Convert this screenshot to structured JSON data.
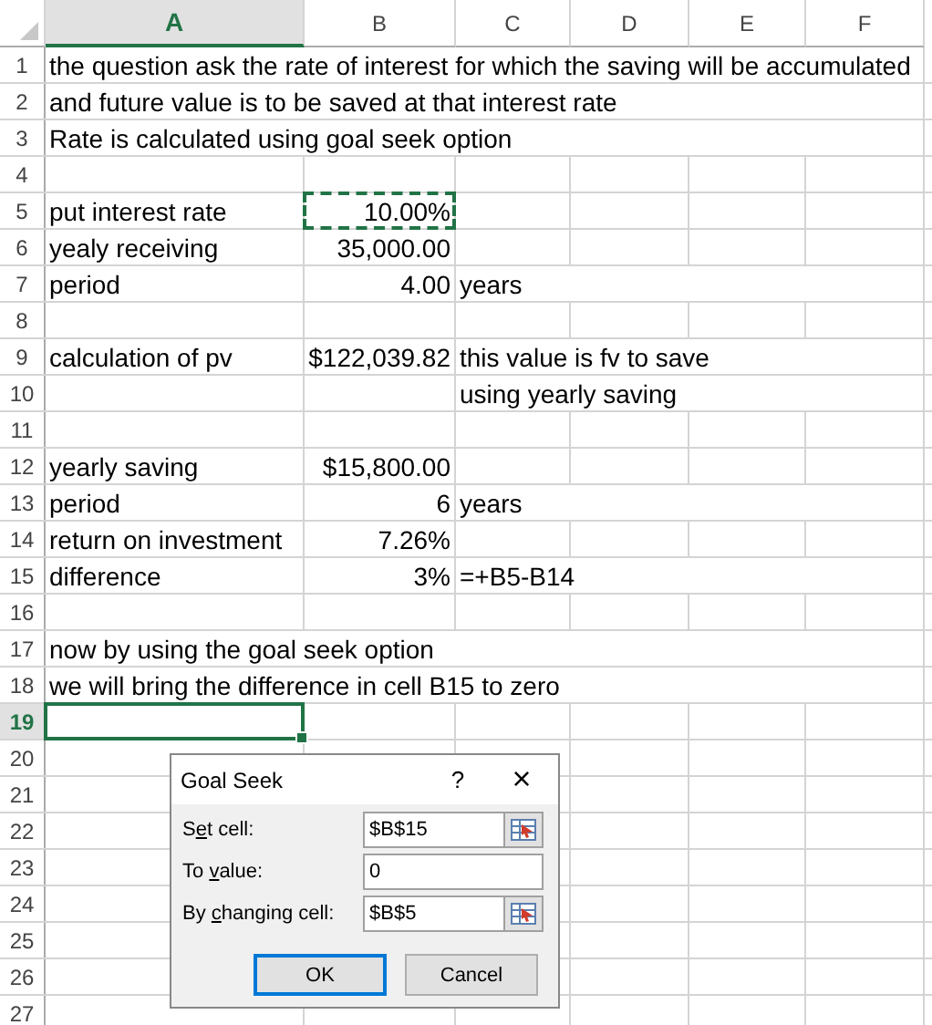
{
  "columns": [
    {
      "label": "A",
      "selected": true
    },
    {
      "label": "B",
      "selected": false
    },
    {
      "label": "C",
      "selected": false
    },
    {
      "label": "D",
      "selected": false
    },
    {
      "label": "E",
      "selected": false
    },
    {
      "label": "F",
      "selected": false
    }
  ],
  "rows": [
    {
      "number": "1",
      "selected": false,
      "cells": [
        {
          "text": "the question ask the rate of interest for which the saving will be accumulated",
          "kind": "text",
          "selected": false
        },
        null,
        null,
        null,
        null,
        null
      ]
    },
    {
      "number": "2",
      "selected": false,
      "cells": [
        {
          "text": "and future value is to be saved at that interest rate",
          "kind": "text",
          "selected": false
        },
        null,
        null,
        null,
        null,
        null
      ]
    },
    {
      "number": "3",
      "selected": false,
      "cells": [
        {
          "text": "Rate is calculated using goal seek option",
          "kind": "text",
          "selected": false
        },
        null,
        null,
        null,
        null,
        null
      ]
    },
    {
      "number": "4",
      "selected": false,
      "cells": [
        null,
        null,
        null,
        null,
        null,
        null
      ]
    },
    {
      "number": "5",
      "selected": false,
      "cells": [
        {
          "text": "put interest rate",
          "kind": "text",
          "selected": false
        },
        {
          "text": "10.00%",
          "kind": "number",
          "selected": false,
          "copied": true
        },
        null,
        null,
        null,
        null
      ]
    },
    {
      "number": "6",
      "selected": false,
      "cells": [
        {
          "text": "yealy receiving",
          "kind": "text",
          "selected": false
        },
        {
          "text": "35,000.00",
          "kind": "number",
          "selected": false
        },
        null,
        null,
        null,
        null
      ]
    },
    {
      "number": "7",
      "selected": false,
      "cells": [
        {
          "text": "period",
          "kind": "text",
          "selected": false
        },
        {
          "text": "4.00",
          "kind": "number",
          "selected": false
        },
        {
          "text": "years",
          "kind": "text",
          "selected": false
        },
        null,
        null,
        null
      ]
    },
    {
      "number": "8",
      "selected": false,
      "cells": [
        null,
        null,
        null,
        null,
        null,
        null
      ]
    },
    {
      "number": "9",
      "selected": false,
      "cells": [
        {
          "text": "calculation of pv",
          "kind": "text",
          "selected": false
        },
        {
          "text": "$122,039.82",
          "kind": "number",
          "selected": false
        },
        {
          "text": "this value is fv to save",
          "kind": "text",
          "selected": false
        },
        null,
        null,
        null
      ]
    },
    {
      "number": "10",
      "selected": false,
      "cells": [
        null,
        null,
        {
          "text": "using yearly saving",
          "kind": "text",
          "selected": false
        },
        null,
        null,
        null
      ]
    },
    {
      "number": "11",
      "selected": false,
      "cells": [
        null,
        null,
        null,
        null,
        null,
        null
      ]
    },
    {
      "number": "12",
      "selected": false,
      "cells": [
        {
          "text": "yearly saving",
          "kind": "text",
          "selected": false
        },
        {
          "text": "$15,800.00",
          "kind": "number",
          "selected": false
        },
        null,
        null,
        null,
        null
      ]
    },
    {
      "number": "13",
      "selected": false,
      "cells": [
        {
          "text": "period",
          "kind": "text",
          "selected": false
        },
        {
          "text": "6",
          "kind": "number",
          "selected": false
        },
        {
          "text": "years",
          "kind": "text",
          "selected": false
        },
        null,
        null,
        null
      ]
    },
    {
      "number": "14",
      "selected": false,
      "cells": [
        {
          "text": "return on investment",
          "kind": "text",
          "selected": false
        },
        {
          "text": "7.26%",
          "kind": "number",
          "selected": false
        },
        null,
        null,
        null,
        null
      ]
    },
    {
      "number": "15",
      "selected": false,
      "cells": [
        {
          "text": "difference",
          "kind": "text",
          "selected": false
        },
        {
          "text": "3%",
          "kind": "number",
          "selected": false
        },
        {
          "text": "=+B5-B14",
          "kind": "text",
          "selected": false
        },
        null,
        null,
        null
      ]
    },
    {
      "number": "16",
      "selected": false,
      "cells": [
        null,
        null,
        null,
        null,
        null,
        null
      ]
    },
    {
      "number": "17",
      "selected": false,
      "cells": [
        {
          "text": "now by using the goal seek option",
          "kind": "text",
          "selected": false
        },
        null,
        null,
        null,
        null,
        null
      ]
    },
    {
      "number": "18",
      "selected": false,
      "cells": [
        {
          "text": "we will bring the difference in cell B15 to zero",
          "kind": "text",
          "selected": false
        },
        null,
        null,
        null,
        null,
        null
      ]
    },
    {
      "number": "19",
      "selected": true,
      "cells": [
        {
          "selected": true
        },
        null,
        null,
        null,
        null,
        null
      ]
    },
    {
      "number": "20",
      "selected": false,
      "cells": [
        null,
        null,
        null,
        null,
        null,
        null
      ]
    },
    {
      "number": "21",
      "selected": false,
      "cells": [
        null,
        null,
        null,
        null,
        null,
        null
      ]
    },
    {
      "number": "22",
      "selected": false,
      "cells": [
        null,
        null,
        null,
        null,
        null,
        null
      ]
    },
    {
      "number": "23",
      "selected": false,
      "cells": [
        null,
        null,
        null,
        null,
        null,
        null
      ]
    },
    {
      "number": "24",
      "selected": false,
      "cells": [
        null,
        null,
        null,
        null,
        null,
        null
      ]
    },
    {
      "number": "25",
      "selected": false,
      "cells": [
        null,
        null,
        null,
        null,
        null,
        null
      ]
    },
    {
      "number": "26",
      "selected": false,
      "cells": [
        null,
        null,
        null,
        null,
        null,
        null
      ]
    },
    {
      "number": "27",
      "selected": false,
      "cells": [
        null,
        null,
        null,
        null,
        null,
        null
      ]
    }
  ],
  "dialog": {
    "title": "Goal Seek",
    "help": "?",
    "close": "×",
    "fields": [
      {
        "label_before": "S",
        "mnemonic": "e",
        "label_after": "t cell:",
        "value": "$B$15",
        "picker": true
      },
      {
        "label_before": "To ",
        "mnemonic": "v",
        "label_after": "alue:",
        "value": "0",
        "picker": false
      },
      {
        "label_before": "By ",
        "mnemonic": "c",
        "label_after": "hanging cell:",
        "value": "$B$5",
        "picker": true
      }
    ],
    "buttons": [
      {
        "label": "OK",
        "default": true
      },
      {
        "label": "Cancel",
        "default": false
      }
    ]
  }
}
